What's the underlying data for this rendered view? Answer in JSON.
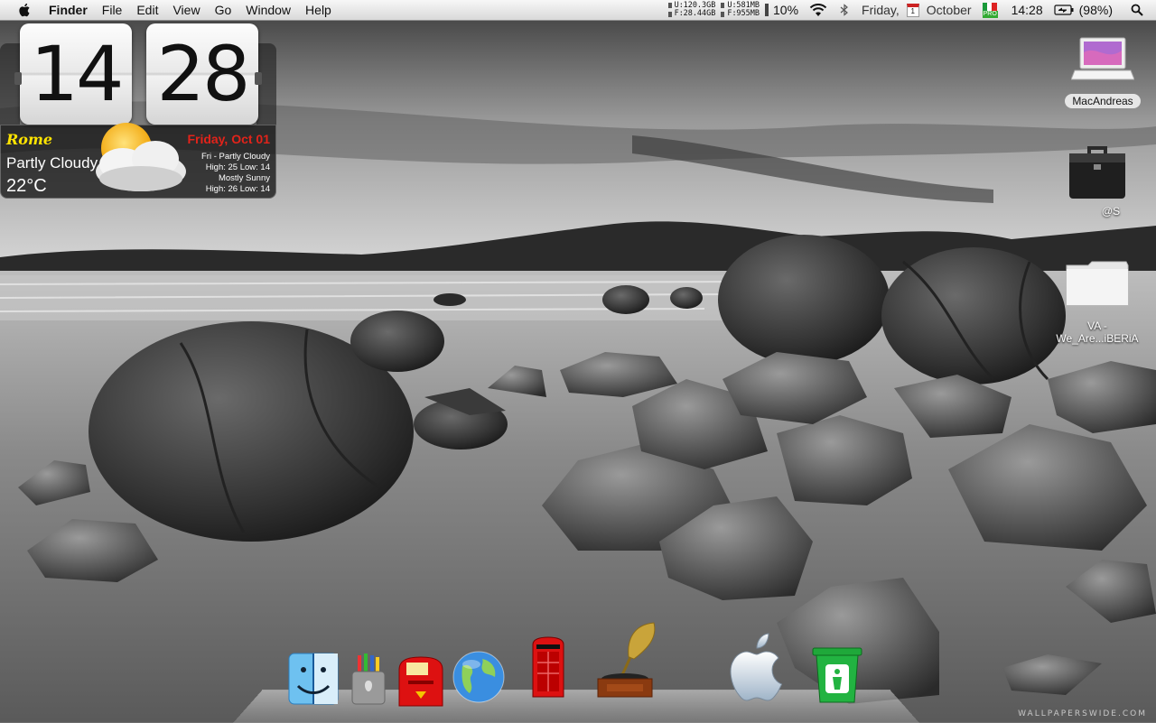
{
  "menubar": {
    "app_name": "Finder",
    "menus": [
      "File",
      "Edit",
      "View",
      "Go",
      "Window",
      "Help"
    ],
    "disk_stats": [
      {
        "key": "U:",
        "value": "120.3GB"
      },
      {
        "key": "F:",
        "value": "28.44GB"
      }
    ],
    "mem_stats": [
      {
        "key": "U:",
        "value": "581MB"
      },
      {
        "key": "F:",
        "value": "955MB"
      }
    ],
    "cpu": "10%",
    "day": "Friday,",
    "calendar_day": "1",
    "month": "October",
    "flag_badge": "PRO",
    "time": "14:28",
    "battery": "(98%)",
    "icons": [
      "apple-icon",
      "wifi-icon",
      "bluetooth-icon",
      "calendar-icon",
      "flag-icon",
      "battery-icon",
      "spotlight-icon"
    ]
  },
  "clock_widget": {
    "hours": "14",
    "minutes": "28",
    "city": "Rome",
    "date": "Friday, Oct 01",
    "condition": "Partly Cloudy",
    "temperature": "22°C",
    "forecast": [
      "Fri - Partly Cloudy",
      "High: 25 Low: 14",
      "Mostly Sunny",
      "High: 26 Low: 14"
    ],
    "icon": "partly-cloudy-icon"
  },
  "desktop_icons": [
    {
      "label": "MacAndreas",
      "icon": "laptop-icon",
      "selected": true
    },
    {
      "label": "@S",
      "icon": "briefcase-icon",
      "selected": false
    },
    {
      "label_line1": "VA -",
      "label_line2": "We_Are...iBERiA",
      "icon": "folder-icon",
      "selected": false
    }
  ],
  "dock": {
    "items": [
      "finder-icon",
      "pencil-cup-icon",
      "mailbox-icon",
      "globe-icon",
      "phone-booth-icon",
      "gramophone-icon",
      "apple-logo-icon",
      "trash-icon"
    ]
  },
  "watermark": "WALLPAPERSWIDE.COM"
}
